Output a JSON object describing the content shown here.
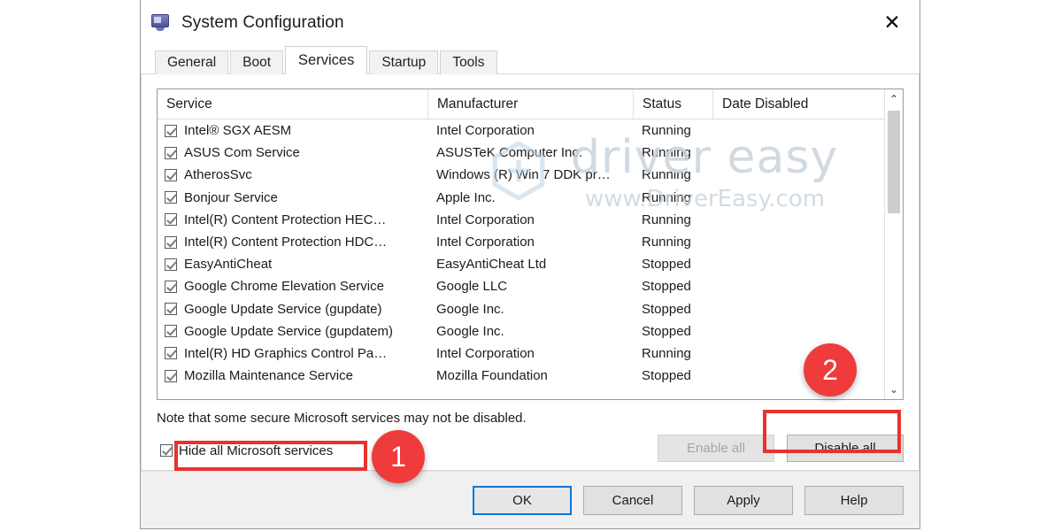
{
  "window": {
    "title": "System Configuration",
    "icon": "monitor-icon",
    "close_label": "✕"
  },
  "tabs": [
    {
      "label": "General",
      "active": false
    },
    {
      "label": "Boot",
      "active": false
    },
    {
      "label": "Services",
      "active": true
    },
    {
      "label": "Startup",
      "active": false
    },
    {
      "label": "Tools",
      "active": false
    }
  ],
  "list": {
    "columns": [
      "Service",
      "Manufacturer",
      "Status",
      "Date Disabled"
    ],
    "rows": [
      {
        "checked": true,
        "service": "Intel® SGX AESM",
        "manufacturer": "Intel Corporation",
        "status": "Running",
        "date": ""
      },
      {
        "checked": true,
        "service": "ASUS Com Service",
        "manufacturer": "ASUSTeK Computer Inc.",
        "status": "Running",
        "date": ""
      },
      {
        "checked": true,
        "service": "AtherosSvc",
        "manufacturer": "Windows (R) Win 7 DDK pr…",
        "status": "Running",
        "date": ""
      },
      {
        "checked": true,
        "service": "Bonjour Service",
        "manufacturer": "Apple Inc.",
        "status": "Running",
        "date": ""
      },
      {
        "checked": true,
        "service": "Intel(R) Content Protection HEC…",
        "manufacturer": "Intel Corporation",
        "status": "Running",
        "date": ""
      },
      {
        "checked": true,
        "service": "Intel(R) Content Protection HDC…",
        "manufacturer": "Intel Corporation",
        "status": "Running",
        "date": ""
      },
      {
        "checked": true,
        "service": "EasyAntiCheat",
        "manufacturer": "EasyAntiCheat Ltd",
        "status": "Stopped",
        "date": ""
      },
      {
        "checked": true,
        "service": "Google Chrome Elevation Service",
        "manufacturer": "Google LLC",
        "status": "Stopped",
        "date": ""
      },
      {
        "checked": true,
        "service": "Google Update Service (gupdate)",
        "manufacturer": "Google Inc.",
        "status": "Stopped",
        "date": ""
      },
      {
        "checked": true,
        "service": "Google Update Service (gupdatem)",
        "manufacturer": "Google Inc.",
        "status": "Stopped",
        "date": ""
      },
      {
        "checked": true,
        "service": "Intel(R) HD Graphics Control Pa…",
        "manufacturer": "Intel Corporation",
        "status": "Running",
        "date": ""
      },
      {
        "checked": true,
        "service": "Mozilla Maintenance Service",
        "manufacturer": "Mozilla Foundation",
        "status": "Stopped",
        "date": ""
      }
    ],
    "scroll_up_icon": "⌃",
    "scroll_down_icon": "⌄"
  },
  "note": "Note that some secure Microsoft services may not be disabled.",
  "hide_microsoft": {
    "label": "Hide all Microsoft services",
    "checked": true
  },
  "actions": {
    "enable_all": "Enable all",
    "disable_all": "Disable all"
  },
  "footer": {
    "ok": "OK",
    "cancel": "Cancel",
    "apply": "Apply",
    "help": "Help"
  },
  "annotations": {
    "step1": "1",
    "step2": "2",
    "highlight_color": "#e8322e",
    "circle_color": "#ef3b3b"
  },
  "watermark": {
    "main": "driver easy",
    "sub": "www.DriverEasy.com"
  }
}
